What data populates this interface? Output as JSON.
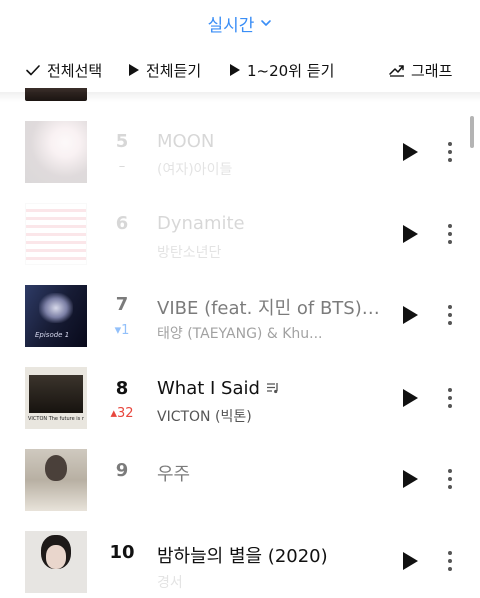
{
  "header": {
    "chart_selector": "실시간",
    "select_all": "전체선택",
    "play_all": "전체듣기",
    "play_range": "1~20위 듣기",
    "graph": "그래프"
  },
  "songs": [
    {
      "rank": "5",
      "change": "–",
      "title": "MOON",
      "artist": "(여자)아이들"
    },
    {
      "rank": "6",
      "change": "",
      "title": "Dynamite",
      "artist": "방탄소년단"
    },
    {
      "rank": "7",
      "change": "▾1",
      "title": "VIBE (feat. 지민 of BTS) (P...",
      "artist": "태양 (TAEYANG) & Khu..."
    },
    {
      "rank": "8",
      "change": "▴32",
      "title": "What I Said",
      "artist": "VICTON (빅톤)"
    },
    {
      "rank": "9",
      "change": "",
      "title": "우주",
      "artist": ""
    },
    {
      "rank": "10",
      "change": "",
      "title": "밤하늘의 별을 (2020)",
      "artist": "경서"
    }
  ],
  "album_art": {
    "song_8_caption": "VICTON The future is now",
    "song_7_caption": "Episode 1"
  },
  "colors": {
    "accent": "#3a8ef6",
    "rank_up": "#e8473e",
    "rank_down": "#3a8ef6"
  },
  "icons": [
    "chevron-down-icon",
    "check-icon",
    "play-icon",
    "graph-icon",
    "more-icon",
    "lyrics-icon"
  ]
}
